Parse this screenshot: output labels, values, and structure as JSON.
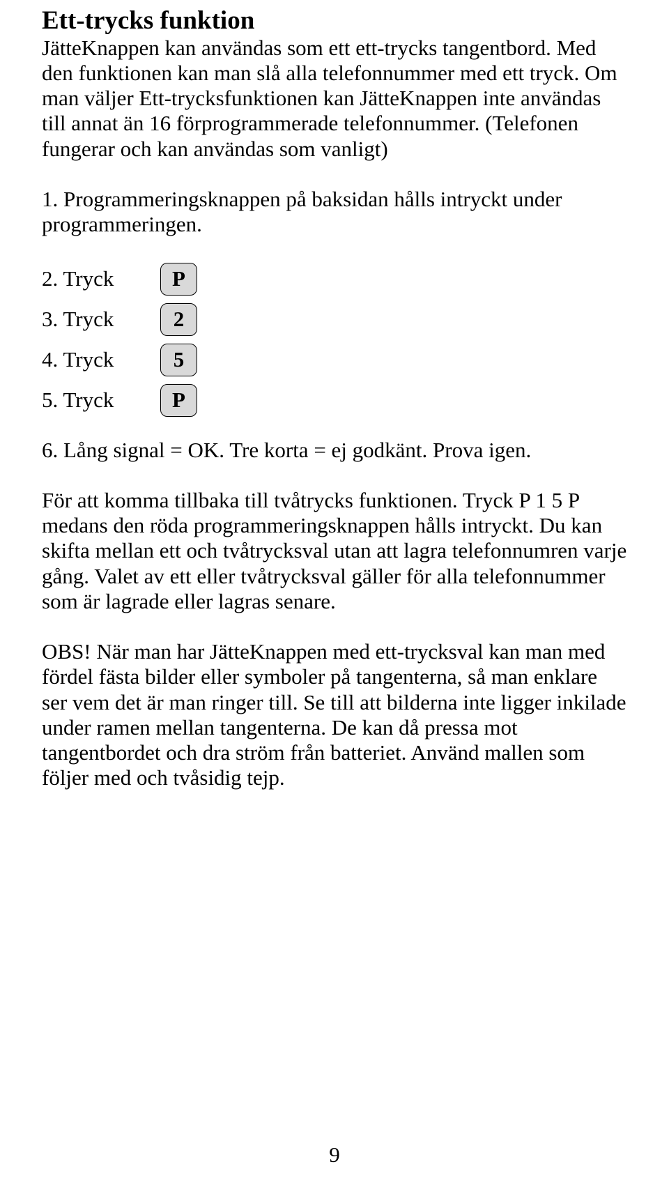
{
  "title": "Ett-trycks funktion",
  "intro_p1": "JätteKnappen kan användas som ett ett-trycks tangentbord. Med den funktionen kan man slå alla telefonnummer med ett tryck. Om man väljer Ett-trycksfunktionen kan JätteKnappen  inte användas till annat än 16 förprogrammerade telefonnummer. (Telefonen fungerar och kan användas som vanligt)",
  "steps": {
    "s1": "1. Programmeringsknappen på baksidan hålls intryckt under programmeringen.",
    "s2": {
      "label": "2. Tryck",
      "key": "P"
    },
    "s3": {
      "label": "3. Tryck",
      "key": "2"
    },
    "s4": {
      "label": "4. Tryck",
      "key": "5"
    },
    "s5": {
      "label": "5. Tryck",
      "key": "P"
    },
    "s6": "6. Lång signal = OK. Tre korta = ej godkänt. Prova igen."
  },
  "para_after": "För att komma tillbaka till tvåtrycks funktionen. Tryck P 1 5 P medans den röda programmeringsknappen hålls intryckt. Du kan skifta mellan ett och tvåtrycksval utan att lagra telefonnumren varje gång. Valet av ett eller tvåtrycksval gäller för alla telefonnummer som är lagrade eller lagras senare.",
  "obs": "OBS! När man har JätteKnappen med ett-trycksval kan man med fördel fästa bilder eller symboler på tangenterna, så man enklare ser vem det är man ringer till. Se till att bilderna inte ligger inkilade under ramen mellan tangenterna. De kan då pressa mot tangentbordet och dra ström från batteriet. Använd mallen som följer med och tvåsidig tejp.",
  "page_number": "9"
}
